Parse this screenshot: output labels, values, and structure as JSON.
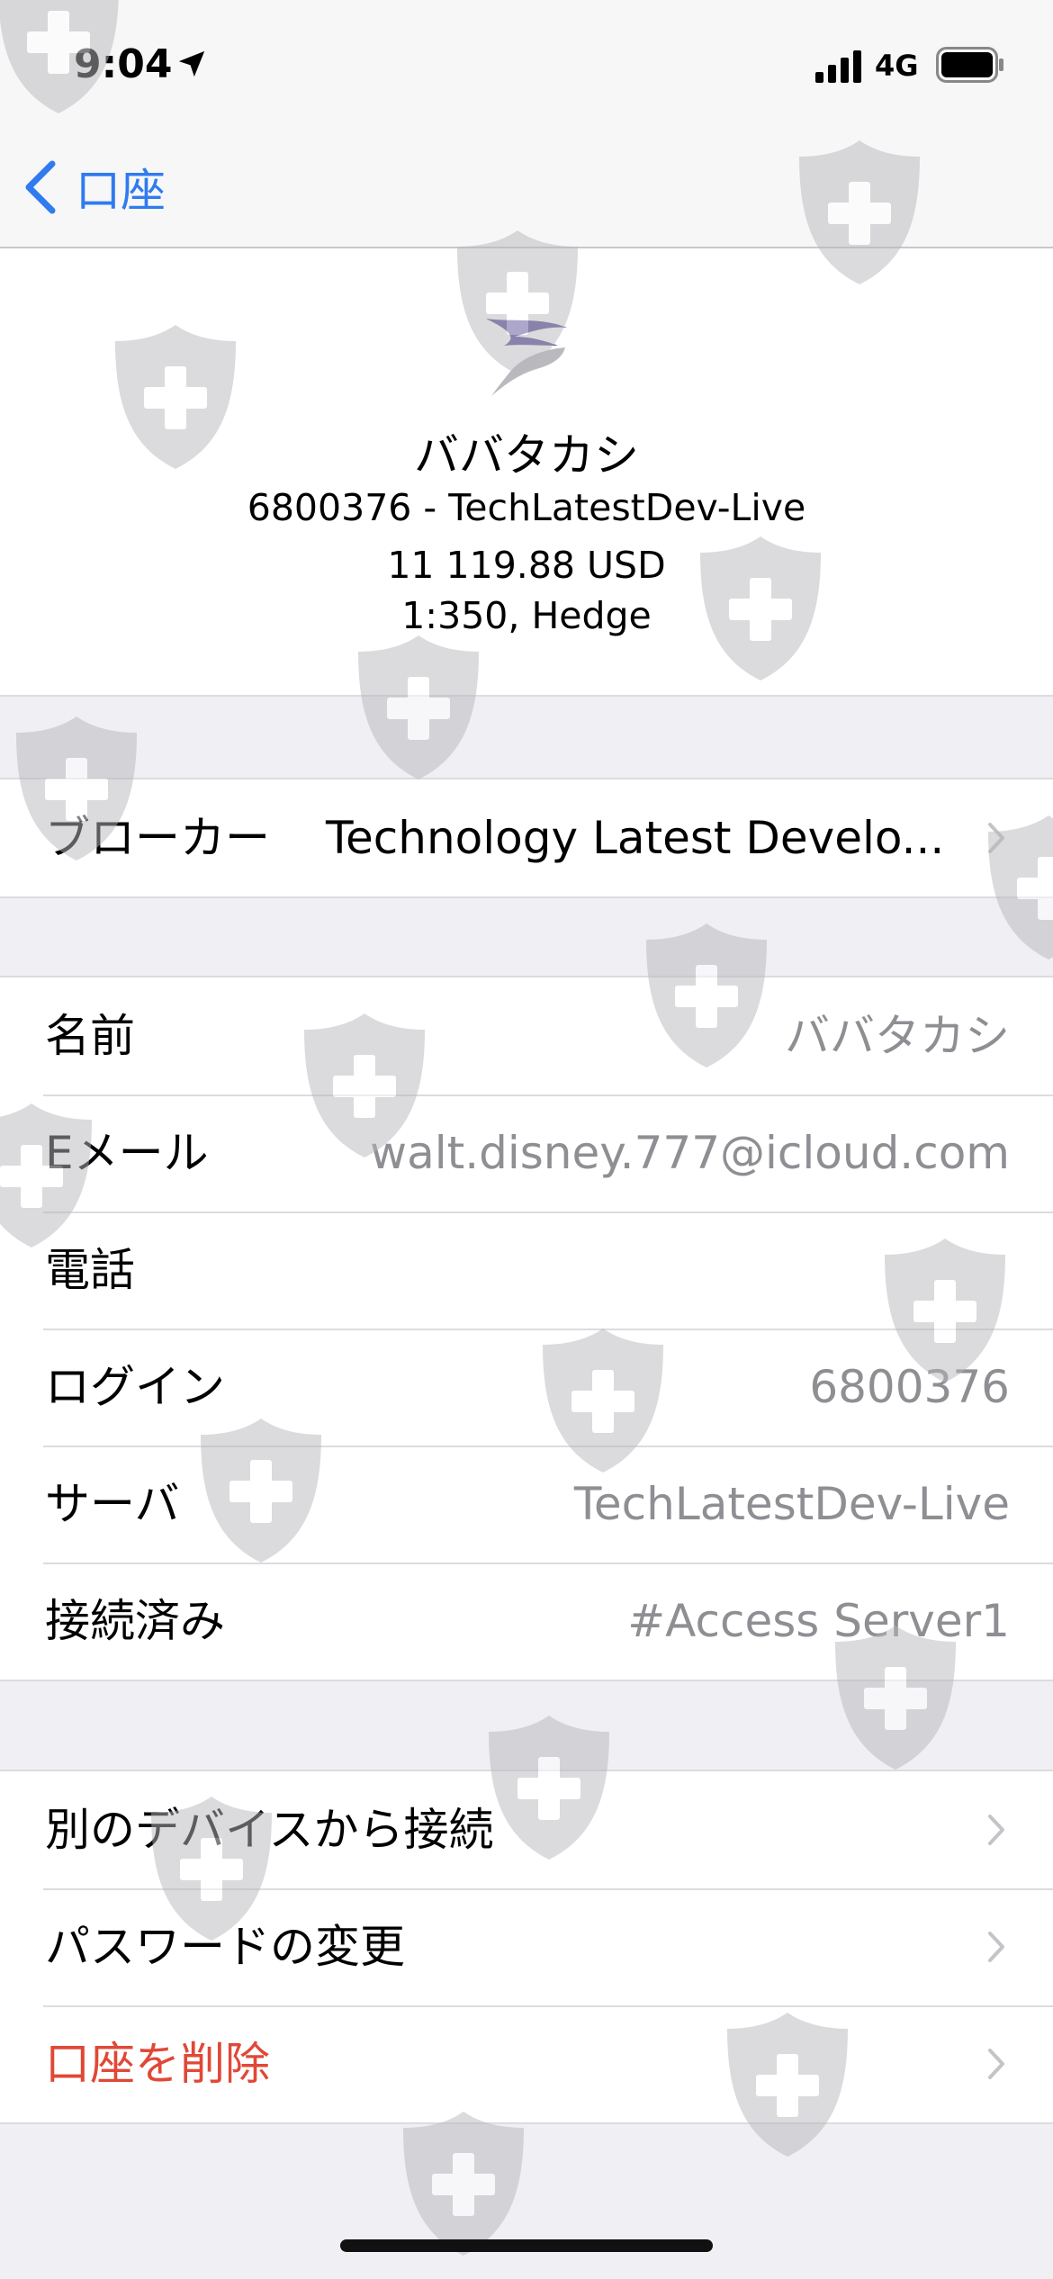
{
  "status_bar": {
    "time": "9:04",
    "network": "4G",
    "icons": [
      "location-arrow-icon",
      "signal-bars-icon",
      "battery-icon"
    ]
  },
  "nav": {
    "back_label": "口座"
  },
  "account": {
    "name": "ババタカシ",
    "login_server": "6800376 - TechLatestDev-Live",
    "balance": "11 119.88 USD",
    "leverage": "1:350, Hedge"
  },
  "broker": {
    "label": "ブローカー",
    "value": "Technology Latest Develo..."
  },
  "details": [
    {
      "label": "名前",
      "value": "ババタカシ"
    },
    {
      "label": "Eメール",
      "value": "walt.disney.777@icloud.com"
    },
    {
      "label": "電話",
      "value": ""
    },
    {
      "label": "ログイン",
      "value": "6800376"
    },
    {
      "label": "サーバ",
      "value": "TechLatestDev-Live"
    },
    {
      "label": "接続済み",
      "value": "#Access Server1"
    }
  ],
  "actions": [
    {
      "label": "別のデバイスから接続"
    },
    {
      "label": "パスワードの変更"
    },
    {
      "label": "口座を削除"
    }
  ],
  "colors": {
    "accent": "#2f7bef",
    "danger": "#e04836",
    "secondary_text": "#8e8e93",
    "background": "#efeff4"
  }
}
